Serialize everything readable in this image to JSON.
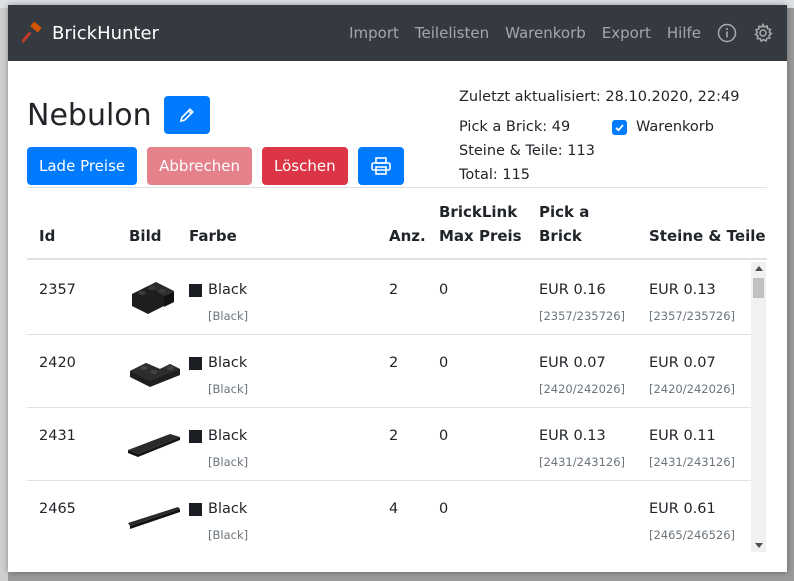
{
  "app": {
    "name": "BrickHunter"
  },
  "nav": {
    "items": [
      "Import",
      "Teilelisten",
      "Warenkorb",
      "Export",
      "Hilfe"
    ]
  },
  "icons": {
    "brand": "brick-hammer-icon",
    "info": "info-icon",
    "settings": "gear-icon",
    "edit": "pencil-icon",
    "print": "printer-icon"
  },
  "list": {
    "title": "Nebulon",
    "updated": "Zuletzt aktualisiert: 28.10.2020, 22:49",
    "pick_a_brick": "Pick a Brick: 49",
    "steine_teile": "Steine & Teile: 113",
    "total": "Total: 115",
    "cart_label": "Warenkorb",
    "cart_checked": true
  },
  "buttons": {
    "load_prices": "Lade Preise",
    "cancel": "Abbrechen",
    "delete": "Löschen"
  },
  "colors": {
    "primary": "#007bff",
    "danger": "#dc3545",
    "danger_light": "#e4818a",
    "navbar": "#343a40"
  },
  "table": {
    "headers": {
      "id": "Id",
      "image": "Bild",
      "color": "Farbe",
      "qty": "Anz.",
      "bricklink_1": "BrickLink",
      "bricklink_2": "Max Preis",
      "pab_1": "Pick a",
      "pab_2": "Brick",
      "st": "Steine & Teile"
    },
    "rows": [
      {
        "id": "2357",
        "color": "Black",
        "color_sub": "[Black]",
        "qty": "2",
        "max_price": "0",
        "pab_price": "EUR 0.16",
        "pab_sub": "[2357/235726]",
        "st_price": "EUR 0.13",
        "st_sub": "[2357/235726]",
        "image": "corner-brick"
      },
      {
        "id": "2420",
        "color": "Black",
        "color_sub": "[Black]",
        "qty": "2",
        "max_price": "0",
        "pab_price": "EUR 0.07",
        "pab_sub": "[2420/242026]",
        "st_price": "EUR 0.07",
        "st_sub": "[2420/242026]",
        "image": "corner-plate"
      },
      {
        "id": "2431",
        "color": "Black",
        "color_sub": "[Black]",
        "qty": "2",
        "max_price": "0",
        "pab_price": "EUR 0.13",
        "pab_sub": "[2431/243126]",
        "st_price": "EUR 0.11",
        "st_sub": "[2431/243126]",
        "image": "tile-1x4"
      },
      {
        "id": "2465",
        "color": "Black",
        "color_sub": "[Black]",
        "qty": "4",
        "max_price": "0",
        "pab_price": "",
        "pab_sub": "",
        "st_price": "EUR 0.61",
        "st_sub": "[2465/246526]",
        "image": "brick-1x16"
      }
    ]
  }
}
